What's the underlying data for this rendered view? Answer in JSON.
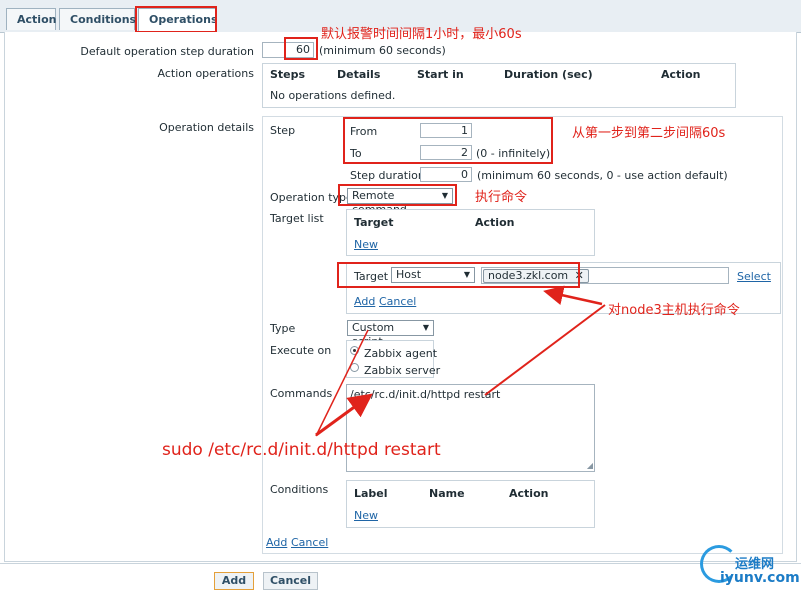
{
  "tabs": [
    {
      "label": "Action"
    },
    {
      "label": "Conditions"
    },
    {
      "label": "Operations"
    }
  ],
  "default_step_duration": {
    "label": "Default operation step duration",
    "value": "60",
    "hint": "(minimum 60 seconds)"
  },
  "action_operations": {
    "label": "Action operations",
    "headers": [
      "Steps",
      "Details",
      "Start in",
      "Duration (sec)",
      "Action"
    ],
    "empty_text": "No operations defined."
  },
  "operation_details": {
    "label": "Operation details",
    "step_label": "Step",
    "from_label": "From",
    "from_value": "1",
    "to_label": "To",
    "to_value": "2",
    "to_hint": "(0 - infinitely)",
    "step_duration_label": "Step duration",
    "step_duration_value": "0",
    "step_duration_hint": "(minimum 60 seconds, 0 - use action default)",
    "operation_type_label": "Operation type",
    "operation_type_value": "Remote command",
    "target_list_label": "Target list",
    "target_list_headers": [
      "Target",
      "Action"
    ],
    "target_list_new": "New",
    "target_label": "Target",
    "target_type_value": "Host",
    "target_host_tag": "node3.zkl.com",
    "select_link": "Select",
    "add_link": "Add",
    "cancel_link": "Cancel",
    "type_label": "Type",
    "type_value": "Custom script",
    "execute_on_label": "Execute on",
    "execute_on_options": [
      "Zabbix agent",
      "Zabbix server"
    ],
    "commands_label": "Commands",
    "commands_value": "/etc/rc.d/init.d/httpd restart",
    "conditions_label": "Conditions",
    "conditions_headers": [
      "Label",
      "Name",
      "Action"
    ],
    "conditions_new": "New",
    "bottom_add": "Add",
    "bottom_cancel": "Cancel"
  },
  "buttons": {
    "add": "Add",
    "cancel": "Cancel"
  },
  "annotations": {
    "interval_note": "默认报警时间间隔1小时，最小60s",
    "step_note": "从第一步到第二步间隔60s",
    "exec_note": "执行命令",
    "host_note": "对node3主机执行命令",
    "command_note": "sudo /etc/rc.d/init.d/httpd restart"
  },
  "watermark": {
    "cn": "运维网",
    "url": "iyunv.com"
  },
  "colors": {
    "annotation_red": "#e0231b",
    "link_blue": "#1f65a6",
    "primary_button_border": "#e4a03a"
  }
}
